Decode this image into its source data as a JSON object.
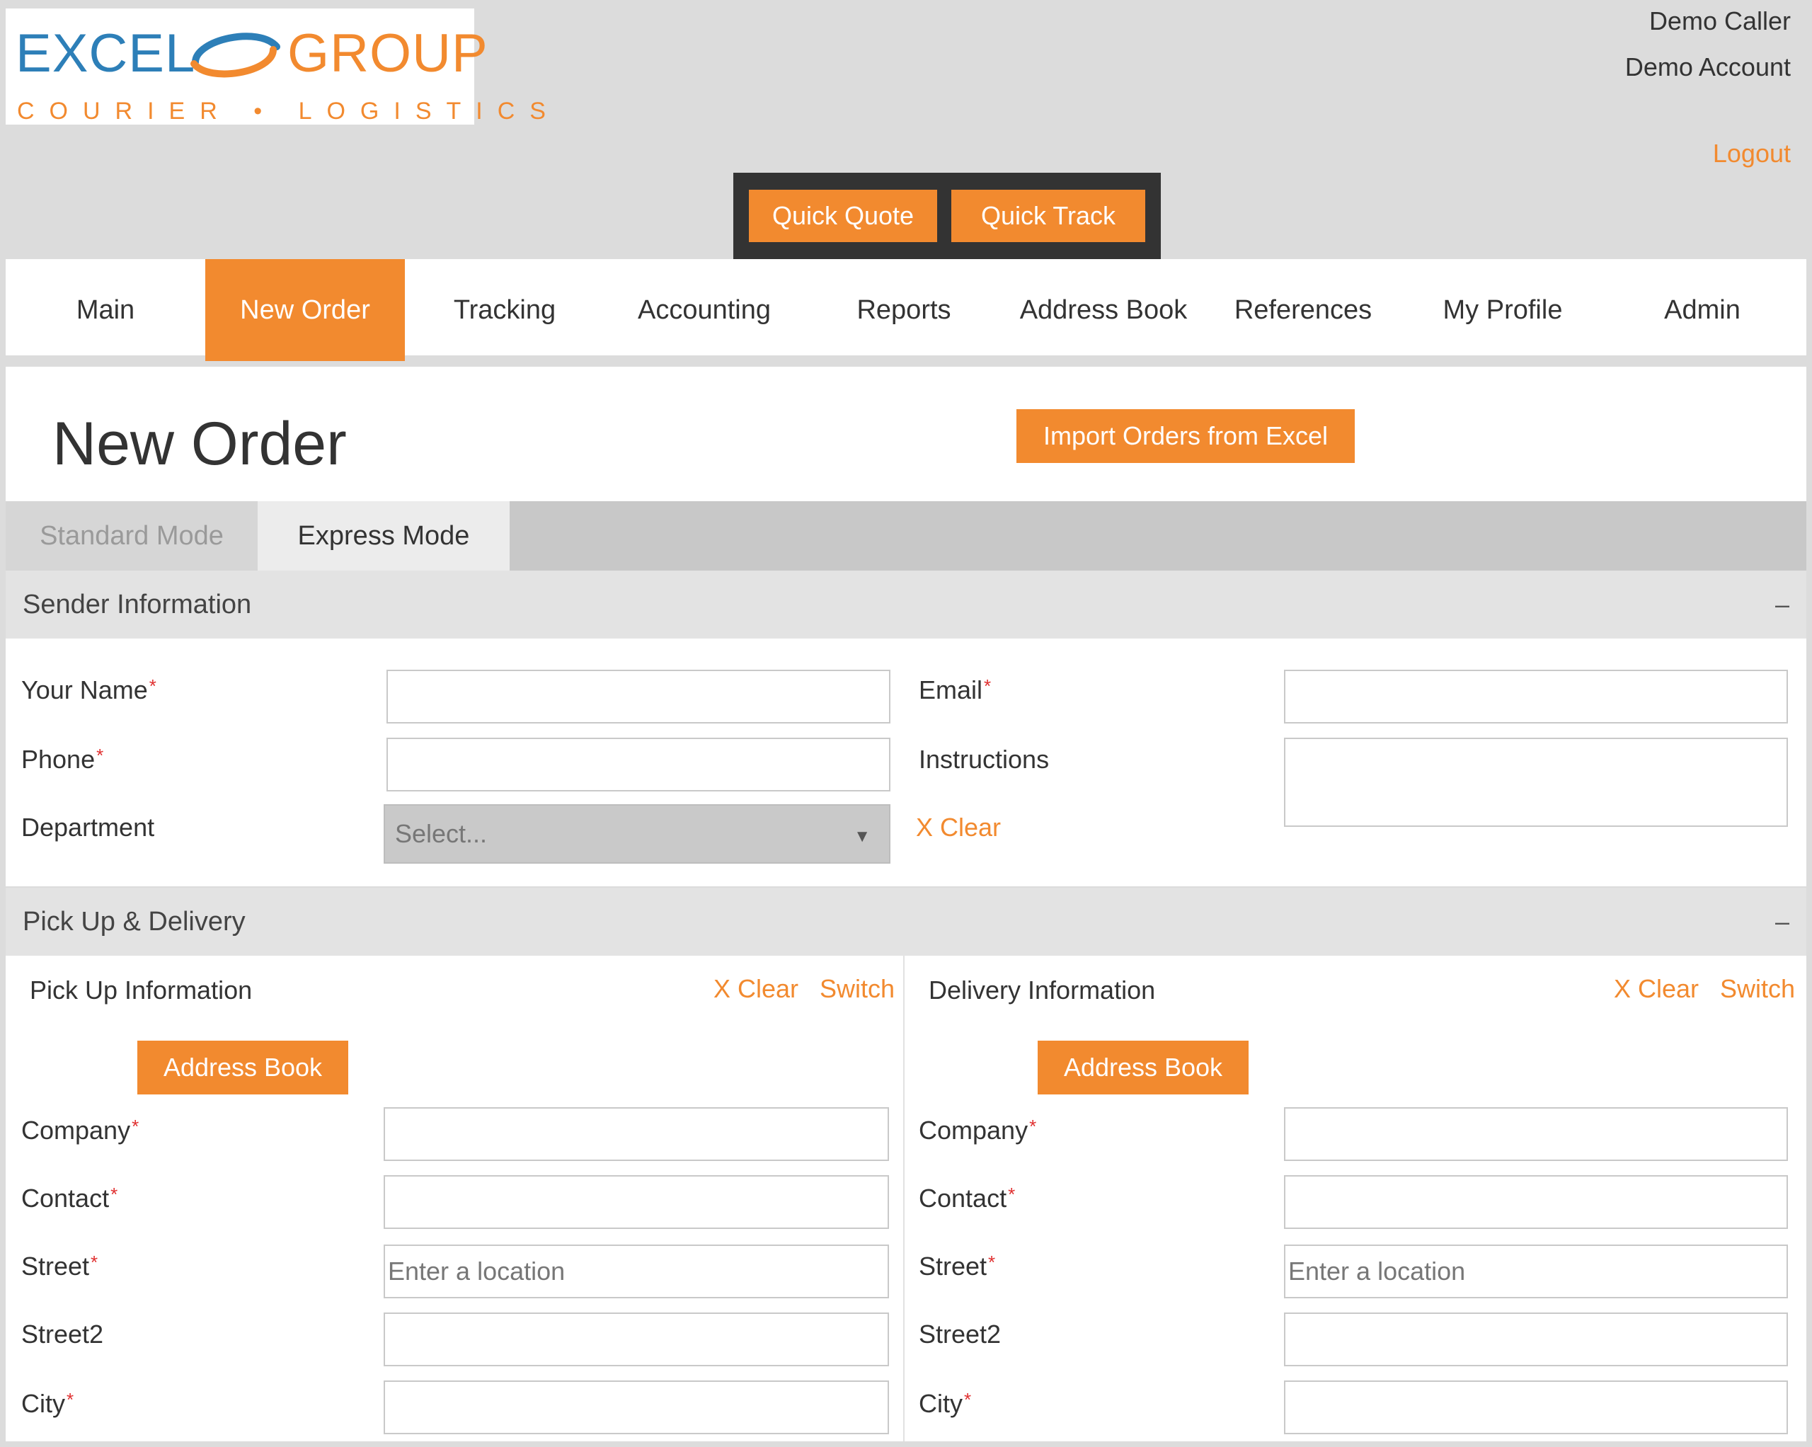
{
  "brand": {
    "name_left": "EXCEL",
    "name_right": "GROUP",
    "tagline": "COURIER • LOGISTICS",
    "primary_color": "#f28a2f",
    "secondary_color": "#2d7fb8"
  },
  "user": {
    "caller": "Demo Caller",
    "account": "Demo Account",
    "logout_label": "Logout"
  },
  "quick": {
    "quote_label": "Quick Quote",
    "track_label": "Quick Track"
  },
  "nav": {
    "items": [
      {
        "label": "Main"
      },
      {
        "label": "New Order",
        "active": true
      },
      {
        "label": "Tracking"
      },
      {
        "label": "Accounting"
      },
      {
        "label": "Reports"
      },
      {
        "label": "Address Book"
      },
      {
        "label": "References"
      },
      {
        "label": "My Profile"
      },
      {
        "label": "Admin"
      }
    ]
  },
  "page": {
    "title": "New Order",
    "import_label": "Import Orders from Excel"
  },
  "modes": {
    "standard": "Standard Mode",
    "express": "Express Mode"
  },
  "sender": {
    "section_title": "Sender Information",
    "collapse_symbol": "–",
    "your_name_label": "Your Name",
    "phone_label": "Phone",
    "department_label": "Department",
    "department_placeholder": "Select...",
    "email_label": "Email",
    "instructions_label": "Instructions",
    "clear_label": "X Clear",
    "required_mark": "*"
  },
  "pickup_delivery": {
    "section_title": "Pick Up & Delivery",
    "collapse_symbol": "–",
    "pickup": {
      "title": "Pick Up Information",
      "clear_label": "X Clear",
      "switch_label": "Switch",
      "address_book_label": "Address Book",
      "company_label": "Company",
      "contact_label": "Contact",
      "street_label": "Street",
      "street_placeholder": "Enter a location",
      "street2_label": "Street2",
      "city_label": "City"
    },
    "delivery": {
      "title": "Delivery Information",
      "clear_label": "X Clear",
      "switch_label": "Switch",
      "address_book_label": "Address Book",
      "company_label": "Company",
      "contact_label": "Contact",
      "street_label": "Street",
      "street_placeholder": "Enter a location",
      "street2_label": "Street2",
      "city_label": "City"
    }
  }
}
